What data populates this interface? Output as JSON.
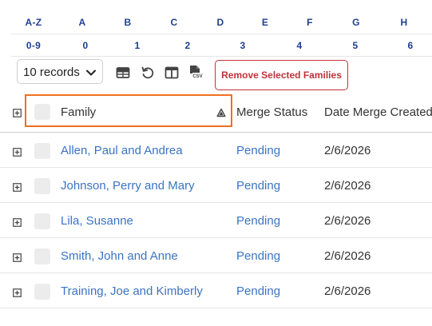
{
  "alpha_filter": {
    "letters": [
      "A-Z",
      "A",
      "B",
      "C",
      "D",
      "E",
      "F",
      "G",
      "H"
    ],
    "digits": [
      "0-9",
      "0",
      "1",
      "2",
      "3",
      "4",
      "5",
      "6"
    ]
  },
  "toolbar": {
    "records_select": {
      "selected": "10 records"
    },
    "icons": [
      "table-view-icon",
      "reset-icon",
      "columns-icon",
      "csv-export-icon"
    ],
    "remove_button_label": "Remove Selected Families"
  },
  "table": {
    "columns": [
      "Family",
      "Merge Status",
      "Date Merge Created"
    ],
    "sort": {
      "column": "Family",
      "direction": "ascending"
    },
    "rows": [
      {
        "family": "Allen, Paul and Andrea",
        "status": "Pending",
        "date": "2/6/2026"
      },
      {
        "family": "Johnson, Perry and Mary",
        "status": "Pending",
        "date": "2/6/2026"
      },
      {
        "family": "Lila, Susanne",
        "status": "Pending",
        "date": "2/6/2026"
      },
      {
        "family": "Smith, John and Anne",
        "status": "Pending",
        "date": "2/6/2026"
      },
      {
        "family": "Training, Joe and Kimberly",
        "status": "Pending",
        "date": "2/6/2026"
      }
    ]
  },
  "colors": {
    "filter_link": "#1f3f8f",
    "link": "#3a74c4",
    "danger": "#c0323a",
    "highlight": "#f07020",
    "checkbox": "#ececec"
  }
}
